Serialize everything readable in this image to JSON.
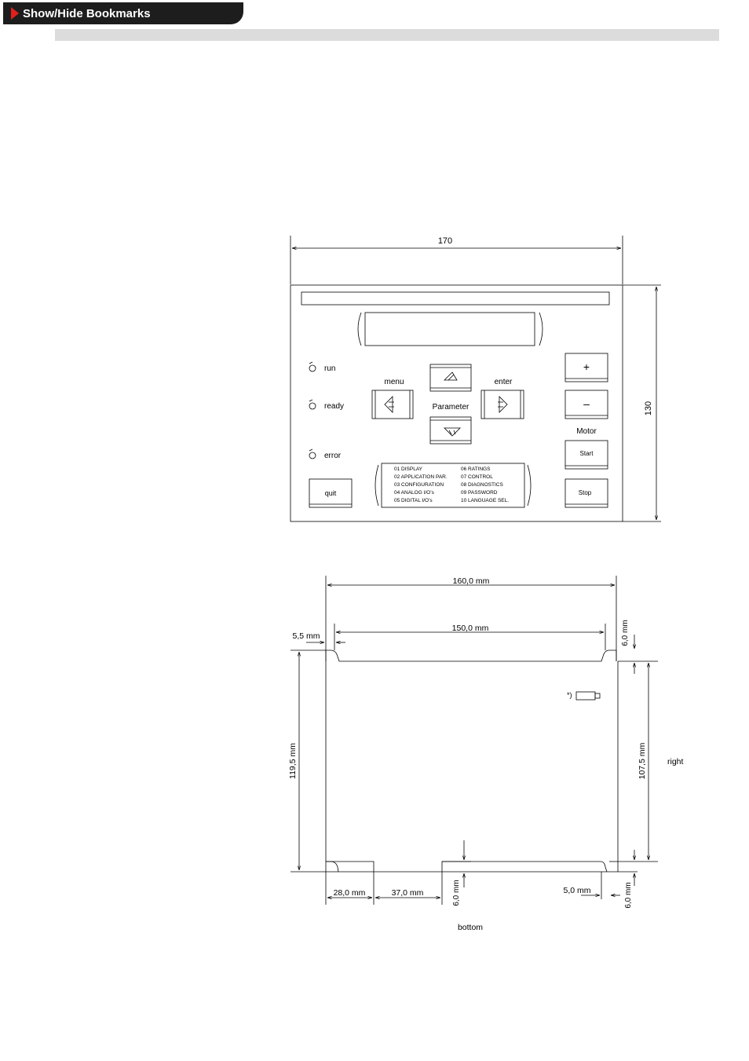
{
  "header": {
    "bookmarks_label": "Show/Hide Bookmarks"
  },
  "keypad": {
    "width_dim": "170",
    "height_dim": "130",
    "leds": {
      "run": "run",
      "ready": "ready",
      "error": "error"
    },
    "buttons": {
      "menu": "menu",
      "enter": "enter",
      "parameter": "Parameter",
      "plus": "+",
      "minus": "–",
      "motor": "Motor",
      "start": "Start",
      "stop": "Stop",
      "quit": "quit"
    },
    "menu_list": {
      "left": [
        "01 DISPLAY",
        "02 APPLICATION PAR.",
        "03 CONFIGURATION",
        "04 ANALOG I/O’s",
        "05 DIGITAL I/O’s"
      ],
      "right": [
        "06 RATINGS",
        "07 CONTROL",
        "08 DIAGNOSTICS",
        "09 PASSWORD",
        "10 LANGUAGE SEL."
      ]
    }
  },
  "cutout": {
    "dim_160": "160,0 mm",
    "dim_150": "150,0 mm",
    "dim_5_5": "5,5 mm",
    "dim_6_top": "6,0 mm",
    "dim_119_5": "119,5 mm",
    "dim_107_5": "107,5 mm",
    "right_label": "right",
    "bottom_label": "bottom",
    "dim_28": "28,0 mm",
    "dim_37": "37,0 mm",
    "dim_6_bottom": "6,0 mm",
    "dim_5": "5,0 mm",
    "dim_6_br": "6,0 mm",
    "note": "*)"
  }
}
